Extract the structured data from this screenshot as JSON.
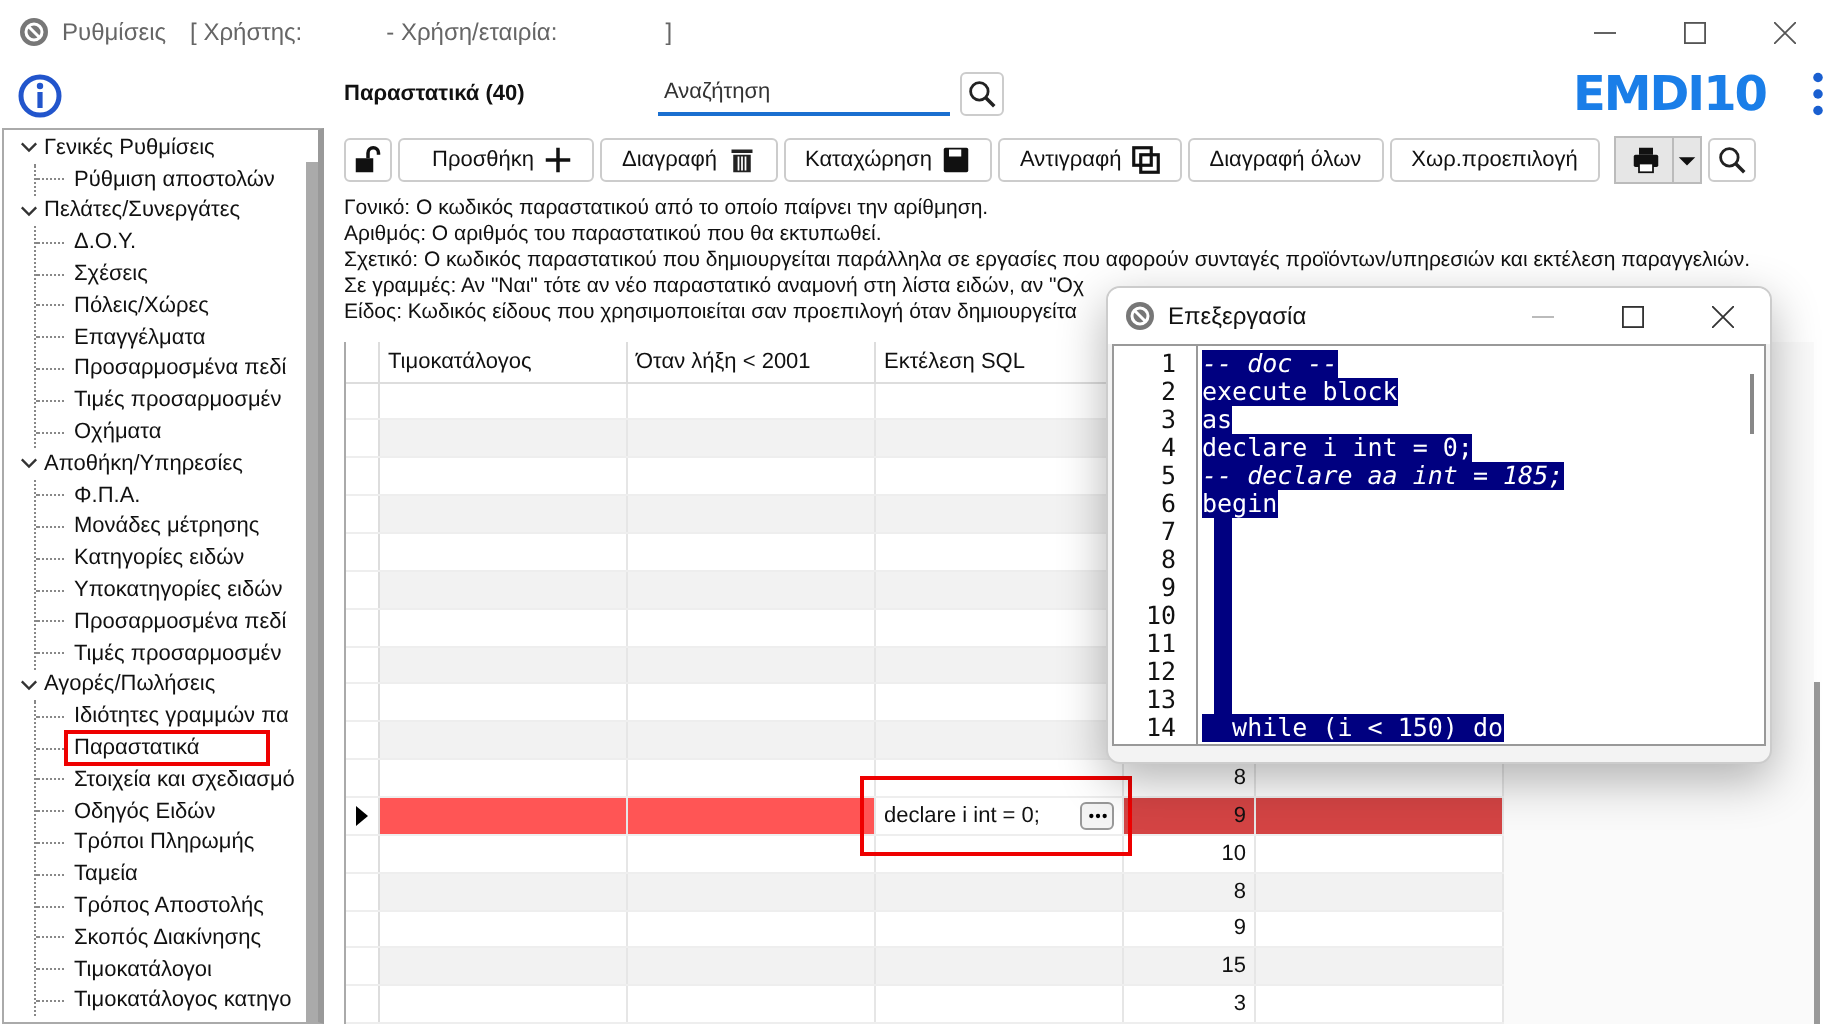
{
  "window": {
    "title": "Ρυθμίσεις",
    "title_user": "[ Χρήστης:",
    "title_company": "- Χρήση/εταιρία:",
    "title_end": "]"
  },
  "sidebar": {
    "tree": [
      {
        "label": "Γενικές Ρυθμίσεις",
        "expanded": true,
        "children": [
          {
            "label": "Ρύθμιση αποστολών",
            "annotated": false
          }
        ]
      },
      {
        "label": "Πελάτες/Συνεργάτες",
        "expanded": true,
        "children": [
          {
            "label": "Δ.Ο.Υ.",
            "annotated": false
          },
          {
            "label": "Σχέσεις",
            "annotated": false
          },
          {
            "label": "Πόλεις/Χώρες",
            "annotated": false
          },
          {
            "label": "Επαγγέλματα",
            "annotated": false
          },
          {
            "label": "Προσαρμοσμένα πεδί",
            "annotated": false
          },
          {
            "label": "Τιμές προσαρμοσμέν",
            "annotated": false
          },
          {
            "label": "Οχήματα",
            "annotated": false
          }
        ]
      },
      {
        "label": "Αποθήκη/Υπηρεσίες",
        "expanded": true,
        "children": [
          {
            "label": "Φ.Π.Α.",
            "annotated": false
          },
          {
            "label": "Μονάδες μέτρησης",
            "annotated": false
          },
          {
            "label": "Κατηγορίες ειδών",
            "annotated": false
          },
          {
            "label": "Υποκατηγορίες ειδών",
            "annotated": false
          },
          {
            "label": "Προσαρμοσμένα πεδί",
            "annotated": false
          },
          {
            "label": "Τιμές προσαρμοσμέν",
            "annotated": false
          }
        ]
      },
      {
        "label": "Αγορές/Πωλήσεις",
        "expanded": true,
        "children": [
          {
            "label": "Ιδιότητες γραμμών πα",
            "annotated": false
          },
          {
            "label": "Παραστατικά",
            "annotated": true
          },
          {
            "label": "Στοιχεία και σχεδιασμό",
            "annotated": false
          },
          {
            "label": "Οδηγός Ειδών",
            "annotated": false
          },
          {
            "label": "Τρόποι Πληρωμής",
            "annotated": false
          },
          {
            "label": "Ταμεία",
            "annotated": false
          },
          {
            "label": "Τρόπος Αποστολής",
            "annotated": false
          },
          {
            "label": "Σκοπός Διακίνησης",
            "annotated": false
          },
          {
            "label": "Τιμοκατάλογοι",
            "annotated": false
          },
          {
            "label": "Τιμοκατάλογος κατηγο",
            "annotated": false
          }
        ]
      }
    ]
  },
  "header": {
    "title": "Παραστατικά (40)",
    "search": {
      "placeholder": "Αναζήτηση"
    },
    "logo": "EMDI10"
  },
  "toolbar": [
    {
      "label": "Προσθήκη"
    },
    {
      "label": "Διαγραφή"
    },
    {
      "label": "Καταχώρηση"
    },
    {
      "label": "Αντιγραφή"
    },
    {
      "label": "Διαγραφή όλων"
    },
    {
      "label": "Χωρ.προεπιλογή"
    }
  ],
  "descriptions": [
    "Γονικό: Ο κωδικός παραστατικού από το οποίο παίρνει την αρίθμηση.",
    "Αριθμός: Ο αριθμός του παραστατικού που θα εκτυπωθεί.",
    "Σχετικό: Ο κωδικός παραστατικού που δημιουργείται παράλληλα σε εργασίες που αφορούν συνταγές προϊόντων/υπηρεσιών και εκτέλεση παραγγελιών.",
    "Σε γραμμές: Αν \"Ναι\" τότε αν νέο παραστατικό αναμονή στη λίστα ειδών, αν \"Οχ",
    "Είδος: Κωδικός είδους που χρησιμοποιείται σαν προεπιλογή όταν δημιουργείτα"
  ],
  "table": {
    "columns": [
      "Τιμοκατάλογος",
      "Όταν λήξη < 2001",
      "Εκτέλεση SQL"
    ],
    "rows": [
      {
        "selected": false
      },
      {
        "selected": false
      },
      {
        "selected": false
      },
      {
        "selected": false
      },
      {
        "selected": false
      },
      {
        "selected": false
      },
      {
        "selected": false
      },
      {
        "selected": false
      },
      {
        "selected": false
      },
      {
        "selected": false
      },
      {
        "selected": false,
        "column_4": "8"
      },
      {
        "selected": true,
        "sql": "declare i int = 0;",
        "column_4": "9",
        "annotated": true
      },
      {
        "selected": false,
        "column_4": "10"
      },
      {
        "selected": false,
        "column_4": "8"
      },
      {
        "selected": false,
        "column_4": "9"
      },
      {
        "selected": false,
        "column_4": "15"
      },
      {
        "selected": false,
        "column_4": "3"
      }
    ]
  },
  "editor_dialog": {
    "title": "Επεξεργασία",
    "lines": [
      {
        "number": "1",
        "kind": "comment",
        "text": "-- doc --"
      },
      {
        "number": "2",
        "kind": "code",
        "text": "execute block"
      },
      {
        "number": "3",
        "kind": "code",
        "text": "as"
      },
      {
        "number": "4",
        "kind": "code",
        "text": "declare i int = 0;"
      },
      {
        "number": "5",
        "kind": "comment",
        "text": "-- declare aa int = 185;"
      },
      {
        "number": "6",
        "kind": "code",
        "text": "begin"
      },
      {
        "number": "7",
        "kind": "blank"
      },
      {
        "number": "8",
        "kind": "blank"
      },
      {
        "number": "9",
        "kind": "blank"
      },
      {
        "number": "10",
        "kind": "blank"
      },
      {
        "number": "11",
        "kind": "blank"
      },
      {
        "number": "12",
        "kind": "blank"
      },
      {
        "number": "13",
        "kind": "blank"
      },
      {
        "number": "14",
        "kind": "code",
        "text": "  while (i < 150) do"
      }
    ]
  }
}
